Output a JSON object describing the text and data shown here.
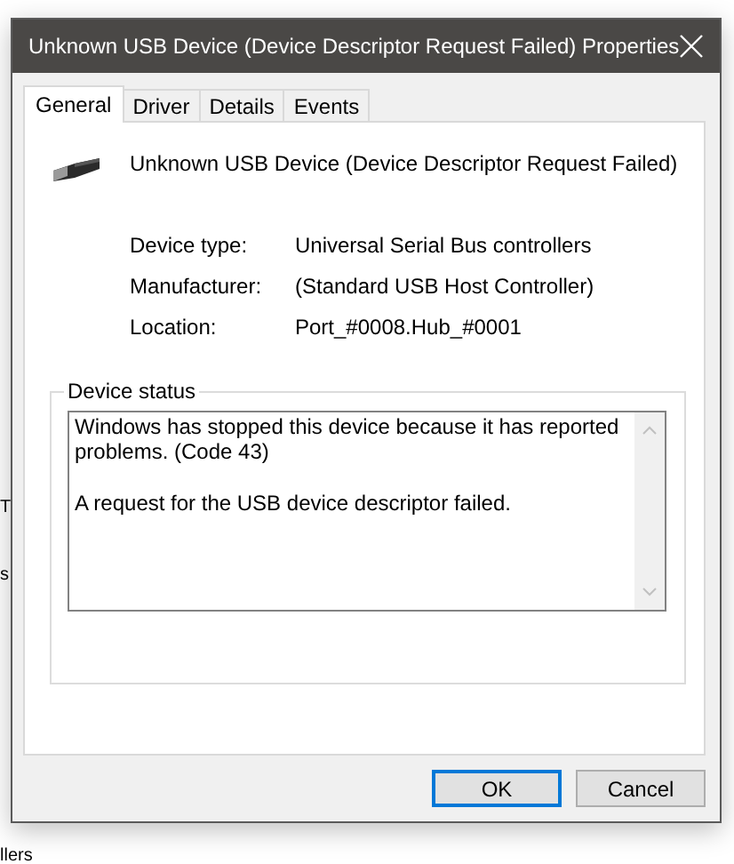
{
  "background": {
    "fragments": [
      "T",
      "s",
      "llers"
    ]
  },
  "window": {
    "title": "Unknown USB Device (Device Descriptor Request Failed) Properties"
  },
  "tabs": [
    {
      "label": "General",
      "selected": true
    },
    {
      "label": "Driver",
      "selected": false
    },
    {
      "label": "Details",
      "selected": false
    },
    {
      "label": "Events",
      "selected": false
    }
  ],
  "device": {
    "name": "Unknown USB Device (Device Descriptor Request Failed)"
  },
  "properties": [
    {
      "label": "Device type:",
      "value": "Universal Serial Bus controllers"
    },
    {
      "label": "Manufacturer:",
      "value": "(Standard USB Host Controller)"
    },
    {
      "label": "Location:",
      "value": "Port_#0008.Hub_#0001"
    }
  ],
  "device_status": {
    "label": "Device status",
    "paragraphs": [
      "Windows has stopped this device because it has reported problems. (Code 43)",
      "A request for the USB device descriptor failed."
    ]
  },
  "buttons": [
    {
      "label": "OK",
      "default": true
    },
    {
      "label": "Cancel",
      "default": false
    }
  ]
}
